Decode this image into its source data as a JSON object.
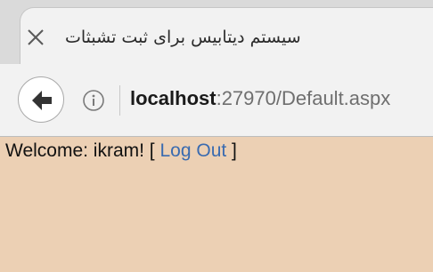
{
  "browser": {
    "tab": {
      "title": "سیستم دیتابیس برای ثبت تشبثات",
      "close_icon": "close-icon"
    },
    "toolbar": {
      "back_icon": "back-arrow-icon",
      "info_icon": "info-icon",
      "url_host": "localhost",
      "url_rest": ":27970/Default.aspx"
    }
  },
  "page": {
    "welcome_prefix": "Welcome: ikram! [ ",
    "logout_label": "Log Out",
    "welcome_suffix": " ]",
    "background_color": "#ecd0b4",
    "link_color": "#3a6bb0"
  }
}
